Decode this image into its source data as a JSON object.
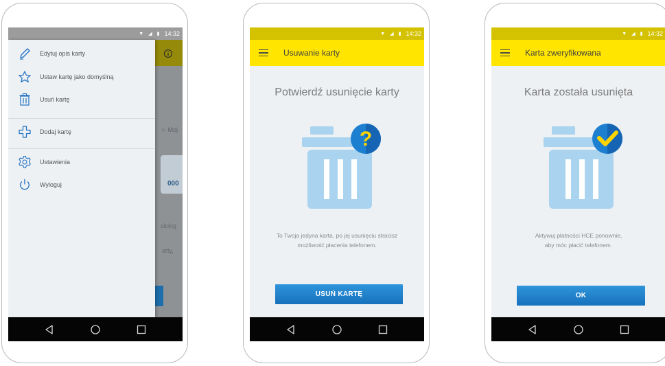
{
  "status_bar": {
    "time": "14:32"
  },
  "phone1": {
    "menu": [
      {
        "label": "Edytuj opis karty",
        "icon": "pencil-icon"
      },
      {
        "label": "Ustaw kartę jako domyślną",
        "icon": "star-icon"
      },
      {
        "label": "Usuń kartę",
        "icon": "trash-icon"
      },
      {
        "label": "Dodaj kartę",
        "icon": "plus-icon"
      },
      {
        "label": "Ustawienia",
        "icon": "gear-icon"
      },
      {
        "label": "Wyloguj",
        "icon": "power-icon"
      }
    ],
    "background_peek": {
      "tab_label": "Moj",
      "card_number": "000",
      "text_1": "sicing",
      "text_2": "arty,"
    }
  },
  "phone2": {
    "title": "Usuwanie karty",
    "heading": "Potwierdź usunięcie karty",
    "badge": "?",
    "message_line1": "To Twoja jedyna karta, po jej usunięciu stracisz",
    "message_line2": "możliwość płacenia telefonem.",
    "button_label": "USUŃ KARTĘ"
  },
  "phone3": {
    "title": "Karta zweryfikowana",
    "heading": "Karta została usunięta",
    "message_line1": "Aktywuj płatności HCE ponownie,",
    "message_line2": "aby móc płacić telefonem.",
    "button_label": "OK"
  },
  "colors": {
    "app_bar": "#ffe500",
    "button": "#1f82cc",
    "trash": "#a9d3ef",
    "badge": "#1d7fd0",
    "badge_mark": "#ffd400",
    "nav_bar": "#050505"
  }
}
